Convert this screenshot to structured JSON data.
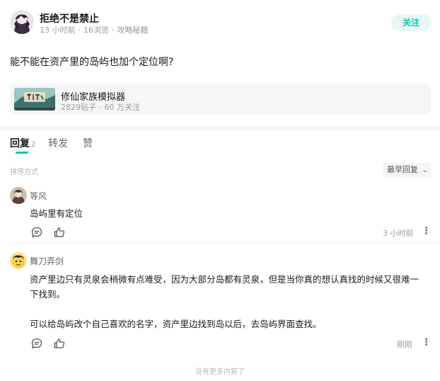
{
  "post": {
    "author": "拒绝不是禁止",
    "time": "13 小时前",
    "views": "16浏览",
    "category": "攻略秘籍",
    "meta_sep": "·",
    "follow_label": "关注",
    "content": "能不能在资产里的岛屿也加个定位啊?"
  },
  "game": {
    "name": "修仙家族模拟器",
    "posts": "2829贴子",
    "follows": "60 万关注",
    "stats_sep": "·"
  },
  "tabs": [
    {
      "label": "回复",
      "count": "2"
    },
    {
      "label": "转发"
    },
    {
      "label": "赞"
    }
  ],
  "sort": {
    "label": "排序方式",
    "value": "最早回复",
    "chevron": "⌄"
  },
  "comments": [
    {
      "author": "等风",
      "lines": [
        "岛屿里有定位"
      ],
      "time": "3 小时前",
      "more": "⋮"
    },
    {
      "author": "舞刀弄剑",
      "lines": [
        "资产里边只有灵泉会稍微有点难受，因为大部分岛都有灵泉，但是当你真的想认真找的时候又很难一下找到。",
        "可以给岛屿改个自己喜欢的名字，资产里边找到岛以后，去岛屿界面查找。"
      ],
      "time": "刚刚",
      "more": "⋮"
    }
  ],
  "footer": {
    "no_more": "没有更多内容了"
  },
  "colors": {
    "accent": "#15bfa8",
    "follow_bg": "#e6f7f6"
  },
  "icons": {
    "comment": "comment-icon",
    "like": "thumbs-up-icon",
    "more": "more-vertical-icon",
    "chevron": "chevron-down-icon"
  }
}
